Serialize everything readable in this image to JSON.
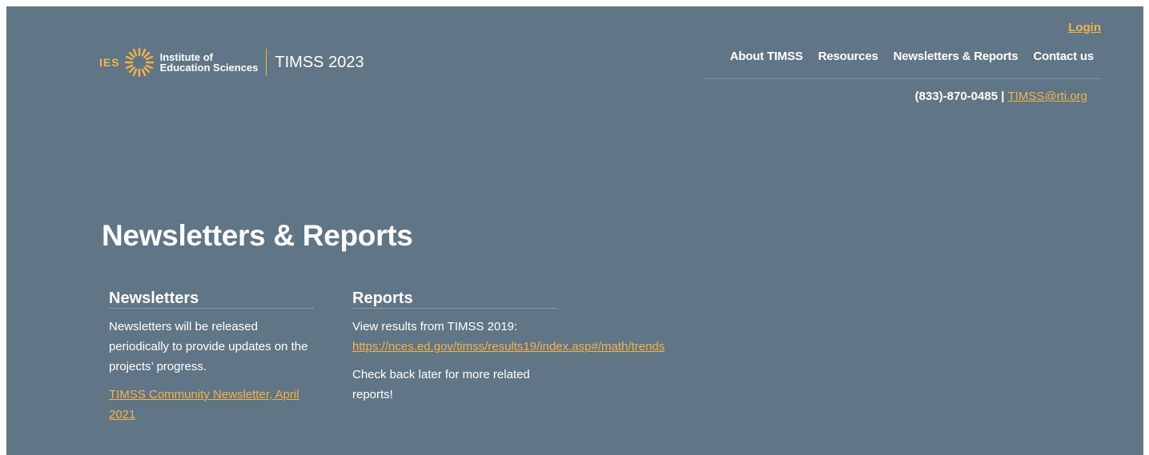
{
  "header": {
    "logo": {
      "ies": "IES",
      "institute_line1": "Institute of",
      "institute_line2": "Education Sciences",
      "product": "TIMSS 2023"
    },
    "login": "Login",
    "nav": [
      "About TIMSS",
      "Resources",
      "Newsletters & Reports",
      "Contact us"
    ],
    "phone": "(833)-870-0485 |",
    "email": "TIMSS@rti.org"
  },
  "main": {
    "title": "Newsletters & Reports",
    "newsletters": {
      "heading": "Newsletters",
      "body": "Newsletters will be released periodically to provide updates on the projects’ progress.",
      "link": "TIMSS Community Newsletter, April 2021"
    },
    "reports": {
      "heading": "Reports",
      "intro": "View results from TIMSS 2019:",
      "link": "https://nces.ed.gov/timss/results19/index.asp#/math/trends",
      "note": "Check back later for more related reports!"
    }
  },
  "colors": {
    "background": "#607585",
    "accent": "#f3b24d",
    "text": "#ffffff"
  }
}
